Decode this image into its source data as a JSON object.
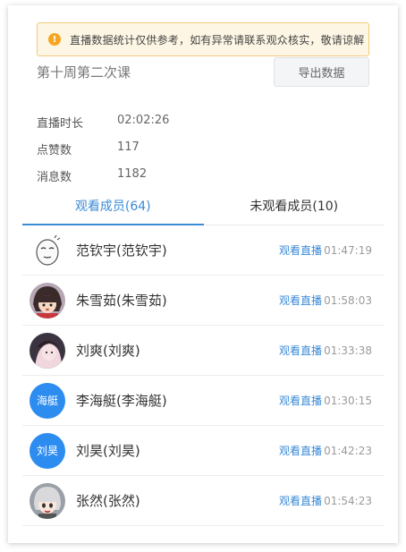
{
  "notice": {
    "icon": "warning-icon",
    "text": "直播数据统计仅供参考，如有异常请联系观众核实，敬请谅解"
  },
  "lesson": {
    "title": "第十周第二次课",
    "export_label": "导出数据"
  },
  "stats": [
    {
      "label": "直播时长",
      "value": "02:02:26"
    },
    {
      "label": "点赞数",
      "value": "117"
    },
    {
      "label": "消息数",
      "value": "1182"
    }
  ],
  "tabs": [
    {
      "label": "观看成员(64)",
      "active": true
    },
    {
      "label": "未观看成员(10)",
      "active": false
    }
  ],
  "members": [
    {
      "name": "范钦宇(范钦宇)",
      "avatar": "cartoon-face-avatar",
      "avatar_text": "",
      "action": "观看直播",
      "time": "01:47:19"
    },
    {
      "name": "朱雪茹(朱雪茹)",
      "avatar": "anime-girl-avatar",
      "avatar_text": "",
      "action": "观看直播",
      "time": "01:58:03"
    },
    {
      "name": "刘爽(刘爽)",
      "avatar": "photo-avatar",
      "avatar_text": "",
      "action": "观看直播",
      "time": "01:33:38"
    },
    {
      "name": "李海艇(李海艇)",
      "avatar": "text-avatar",
      "avatar_text": "海艇",
      "action": "观看直播",
      "time": "01:30:15"
    },
    {
      "name": "刘昊(刘昊)",
      "avatar": "text-avatar",
      "avatar_text": "刘昊",
      "action": "观看直播",
      "time": "01:42:23"
    },
    {
      "name": "张然(张然)",
      "avatar": "anime-character-avatar",
      "avatar_text": "",
      "action": "观看直播",
      "time": "01:54:23"
    }
  ],
  "colors": {
    "accent": "#3a8ad6",
    "text_avatar_bg": "#2d8cf0",
    "notice_bg": "#fdf6e4",
    "notice_border": "#f3c97a",
    "warn_icon": "#f5a623"
  }
}
